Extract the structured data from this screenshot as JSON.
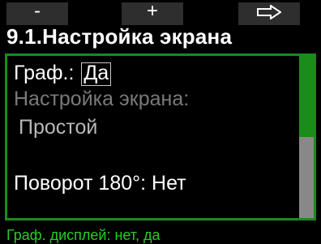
{
  "softkeys": {
    "left_label": "-",
    "middle_label": "+",
    "right_icon": "right-arrow-icon"
  },
  "title": "9.1.Настройка экрана",
  "panel": {
    "graph_label": "Граф.:",
    "graph_value": "Да",
    "setting_label": "Настройка экрана:",
    "mode_value": "Простой",
    "rotate_label": "Поворот 180°:",
    "rotate_value": "Нет"
  },
  "scrollbar": {
    "position_fraction": 0.5
  },
  "hint": "Граф. дисплей: нет, да",
  "colors": {
    "accent": "#1a8c1a",
    "hint_text": "#22d022",
    "softkey_bg": "#2e2e2e",
    "background": "#000000"
  }
}
